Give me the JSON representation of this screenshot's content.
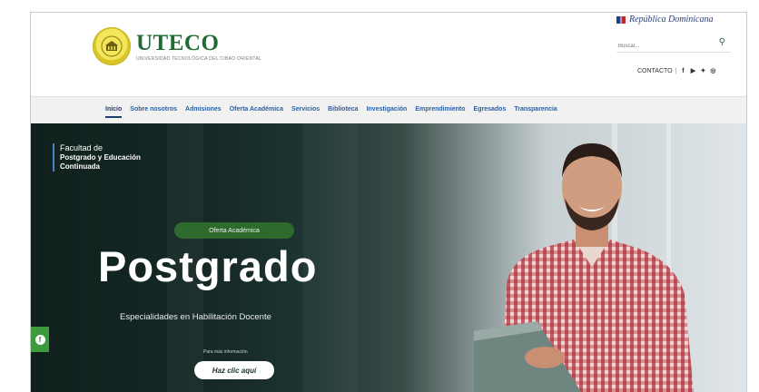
{
  "header": {
    "brand_name": "UTECO",
    "brand_subtitle": "UNIVERSIDAD TECNOLÓGICA DEL CIBAO ORIENTAL",
    "gov_label": "República Dominicana",
    "search_placeholder": "Buscar...",
    "contact_label": "CONTACTO",
    "separator": "|",
    "social_icons": [
      "facebook-icon",
      "youtube-icon",
      "twitter-icon",
      "instagram-icon"
    ]
  },
  "nav": {
    "items": [
      {
        "label": "Inicio",
        "active": true
      },
      {
        "label": "Sobre nosotros"
      },
      {
        "label": "Admisiones"
      },
      {
        "label": "Oferta Académica"
      },
      {
        "label": "Servicios"
      },
      {
        "label": "Biblioteca"
      },
      {
        "label": "Investigación"
      },
      {
        "label": "Emprendimiento"
      },
      {
        "label": "Egresados"
      },
      {
        "label": "Transparencia"
      }
    ]
  },
  "hero": {
    "faculty_line1": "Facultad de",
    "faculty_line2": "Postgrado y Educación",
    "faculty_line3": "Continuada",
    "badge": "Oferta Académica",
    "title": "Postgrado",
    "subtitle": "Especialidades en Habilitación Docente",
    "cta_note": "Para más información",
    "cta_label": "Haz clic aquí"
  },
  "colors": {
    "brand_green": "#1f6b35",
    "nav_blue": "#2a5f9e",
    "badge_green": "#2e6a2e",
    "float_green": "#3d9a3d"
  }
}
